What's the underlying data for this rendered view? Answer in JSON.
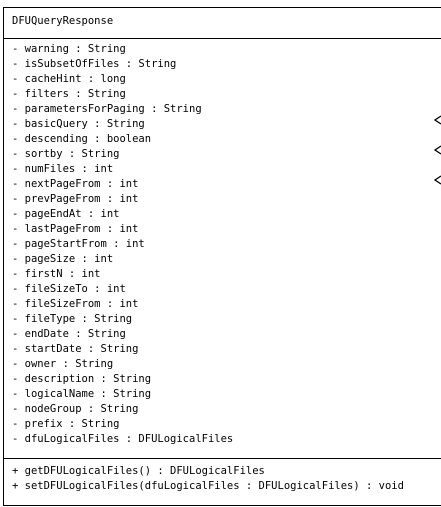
{
  "class": {
    "name": "DFUQueryResponse",
    "attributes": [
      "- warning : String",
      "- isSubsetOfFiles : String",
      "- cacheHint : long",
      "- filters : String",
      "- parametersForPaging : String",
      "- basicQuery : String",
      "- descending : boolean",
      "- sortby : String",
      "- numFiles : int",
      "- nextPageFrom : int",
      "- prevPageFrom : int",
      "- pageEndAt : int",
      "- lastPageFrom : int",
      "- pageStartFrom : int",
      "- pageSize : int",
      "- firstN : int",
      "- fileSizeTo : int",
      "- fileSizeFrom : int",
      "- fileType : String",
      "- endDate : String",
      "- startDate : String",
      "- owner : String",
      "- description : String",
      "- logicalName : String",
      "- nodeGroup : String",
      "- prefix : String",
      "- dfuLogicalFiles : DFULogicalFiles"
    ],
    "operations": [
      "+ getDFULogicalFiles() : DFULogicalFiles",
      "+ setDFULogicalFiles(dfuLogicalFiles : DFULogicalFiles) : void"
    ]
  },
  "colors": {
    "stroke": "#000000",
    "background": "#ffffff"
  }
}
